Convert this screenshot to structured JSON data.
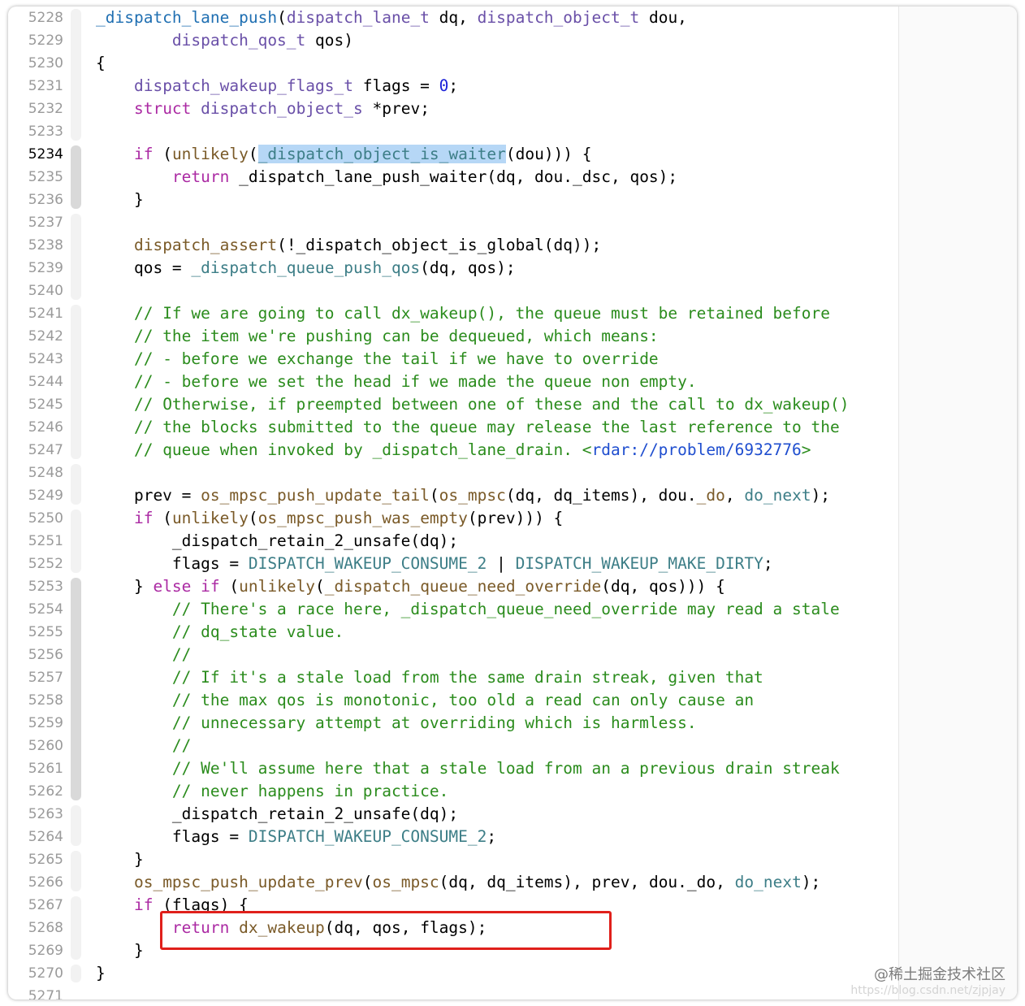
{
  "colors": {
    "keyword": "#ab2aa3",
    "type": "#6a50a8",
    "func": "#3d7e87",
    "def": "#1f6fb2",
    "comment": "#2b8c1d",
    "number": "#1c22d8",
    "link": "#1f4ecf",
    "macro": "#7a5a28",
    "selection": "#b6d7f6",
    "text": "#000000",
    "annotation_box": "#e0201b"
  },
  "active_line": 5234,
  "lines": [
    {
      "n": 5228,
      "tokens": [
        [
          "def",
          "_dispatch_lane_push"
        ],
        [
          "p",
          "("
        ],
        [
          "type",
          "dispatch_lane_t"
        ],
        [
          "p",
          " dq, "
        ],
        [
          "type",
          "dispatch_object_t"
        ],
        [
          "p",
          " dou,"
        ]
      ]
    },
    {
      "n": 5229,
      "tokens": [
        [
          "p",
          "        "
        ],
        [
          "type",
          "dispatch_qos_t"
        ],
        [
          "p",
          " qos)"
        ]
      ]
    },
    {
      "n": 5230,
      "tokens": [
        [
          "p",
          "{"
        ]
      ]
    },
    {
      "n": 5231,
      "tokens": [
        [
          "p",
          "    "
        ],
        [
          "type",
          "dispatch_wakeup_flags_t"
        ],
        [
          "p",
          " flags = "
        ],
        [
          "num",
          "0"
        ],
        [
          "p",
          ";"
        ]
      ]
    },
    {
      "n": 5232,
      "tokens": [
        [
          "p",
          "    "
        ],
        [
          "kw",
          "struct"
        ],
        [
          "p",
          " "
        ],
        [
          "type",
          "dispatch_object_s"
        ],
        [
          "p",
          " *prev;"
        ]
      ]
    },
    {
      "n": 5233,
      "tokens": []
    },
    {
      "n": 5234,
      "tokens": [
        [
          "p",
          "    "
        ],
        [
          "kw",
          "if"
        ],
        [
          "p",
          " ("
        ],
        [
          "macro",
          "unlikely"
        ],
        [
          "p",
          "("
        ],
        [
          "sel",
          "_dispatch_object_is_waiter"
        ],
        [
          "p",
          "(dou))) {"
        ]
      ]
    },
    {
      "n": 5235,
      "tokens": [
        [
          "p",
          "        "
        ],
        [
          "kw",
          "return"
        ],
        [
          "p",
          " _dispatch_lane_push_waiter(dq, dou._dsc, qos);"
        ]
      ]
    },
    {
      "n": 5236,
      "tokens": [
        [
          "p",
          "    }"
        ]
      ]
    },
    {
      "n": 5237,
      "tokens": []
    },
    {
      "n": 5238,
      "tokens": [
        [
          "p",
          "    "
        ],
        [
          "macro",
          "dispatch_assert"
        ],
        [
          "p",
          "(!_dispatch_object_is_global(dq));"
        ]
      ]
    },
    {
      "n": 5239,
      "tokens": [
        [
          "p",
          "    qos = "
        ],
        [
          "func",
          "_dispatch_queue_push_qos"
        ],
        [
          "p",
          "(dq, qos);"
        ]
      ]
    },
    {
      "n": 5240,
      "tokens": []
    },
    {
      "n": 5241,
      "tokens": [
        [
          "p",
          "    "
        ],
        [
          "cm",
          "// If we are going to call dx_wakeup(), the queue must be retained before"
        ]
      ]
    },
    {
      "n": 5242,
      "tokens": [
        [
          "p",
          "    "
        ],
        [
          "cm",
          "// the item we're pushing can be dequeued, which means:"
        ]
      ]
    },
    {
      "n": 5243,
      "tokens": [
        [
          "p",
          "    "
        ],
        [
          "cm",
          "// - before we exchange the tail if we have to override"
        ]
      ]
    },
    {
      "n": 5244,
      "tokens": [
        [
          "p",
          "    "
        ],
        [
          "cm",
          "// - before we set the head if we made the queue non empty."
        ]
      ]
    },
    {
      "n": 5245,
      "tokens": [
        [
          "p",
          "    "
        ],
        [
          "cm",
          "// Otherwise, if preempted between one of these and the call to dx_wakeup()"
        ]
      ]
    },
    {
      "n": 5246,
      "tokens": [
        [
          "p",
          "    "
        ],
        [
          "cm",
          "// the blocks submitted to the queue may release the last reference to the"
        ]
      ]
    },
    {
      "n": 5247,
      "tokens": [
        [
          "p",
          "    "
        ],
        [
          "cm",
          "// queue when invoked by _dispatch_lane_drain. <"
        ],
        [
          "link",
          "rdar://problem/6932776"
        ],
        [
          "cm",
          ">"
        ]
      ]
    },
    {
      "n": 5248,
      "tokens": []
    },
    {
      "n": 5249,
      "tokens": [
        [
          "p",
          "    prev = "
        ],
        [
          "macro",
          "os_mpsc_push_update_tail"
        ],
        [
          "p",
          "("
        ],
        [
          "macro",
          "os_mpsc"
        ],
        [
          "p",
          "(dq, dq_items), dou."
        ],
        [
          "macro",
          "_do"
        ],
        [
          "p",
          ", "
        ],
        [
          "func",
          "do_next"
        ],
        [
          "p",
          ");"
        ]
      ]
    },
    {
      "n": 5250,
      "tokens": [
        [
          "p",
          "    "
        ],
        [
          "kw",
          "if"
        ],
        [
          "p",
          " ("
        ],
        [
          "macro",
          "unlikely"
        ],
        [
          "p",
          "("
        ],
        [
          "macro",
          "os_mpsc_push_was_empty"
        ],
        [
          "p",
          "(prev))) {"
        ]
      ]
    },
    {
      "n": 5251,
      "tokens": [
        [
          "p",
          "        _dispatch_retain_2_unsafe(dq);"
        ]
      ]
    },
    {
      "n": 5252,
      "tokens": [
        [
          "p",
          "        flags = "
        ],
        [
          "func",
          "DISPATCH_WAKEUP_CONSUME_2"
        ],
        [
          "p",
          " | "
        ],
        [
          "func",
          "DISPATCH_WAKEUP_MAKE_DIRTY"
        ],
        [
          "p",
          ";"
        ]
      ]
    },
    {
      "n": 5253,
      "tokens": [
        [
          "p",
          "    } "
        ],
        [
          "kw",
          "else if"
        ],
        [
          "p",
          " ("
        ],
        [
          "macro",
          "unlikely"
        ],
        [
          "p",
          "("
        ],
        [
          "macro",
          "_dispatch_queue_need_override"
        ],
        [
          "p",
          "(dq, qos))) {"
        ]
      ]
    },
    {
      "n": 5254,
      "tokens": [
        [
          "p",
          "        "
        ],
        [
          "cm",
          "// There's a race here, _dispatch_queue_need_override may read a stale"
        ]
      ]
    },
    {
      "n": 5255,
      "tokens": [
        [
          "p",
          "        "
        ],
        [
          "cm",
          "// dq_state value."
        ]
      ]
    },
    {
      "n": 5256,
      "tokens": [
        [
          "p",
          "        "
        ],
        [
          "cm",
          "//"
        ]
      ]
    },
    {
      "n": 5257,
      "tokens": [
        [
          "p",
          "        "
        ],
        [
          "cm",
          "// If it's a stale load from the same drain streak, given that"
        ]
      ]
    },
    {
      "n": 5258,
      "tokens": [
        [
          "p",
          "        "
        ],
        [
          "cm",
          "// the max qos is monotonic, too old a read can only cause an"
        ]
      ]
    },
    {
      "n": 5259,
      "tokens": [
        [
          "p",
          "        "
        ],
        [
          "cm",
          "// unnecessary attempt at overriding which is harmless."
        ]
      ]
    },
    {
      "n": 5260,
      "tokens": [
        [
          "p",
          "        "
        ],
        [
          "cm",
          "//"
        ]
      ]
    },
    {
      "n": 5261,
      "tokens": [
        [
          "p",
          "        "
        ],
        [
          "cm",
          "// We'll assume here that a stale load from an a previous drain streak"
        ]
      ]
    },
    {
      "n": 5262,
      "tokens": [
        [
          "p",
          "        "
        ],
        [
          "cm",
          "// never happens in practice."
        ]
      ]
    },
    {
      "n": 5263,
      "tokens": [
        [
          "p",
          "        _dispatch_retain_2_unsafe(dq);"
        ]
      ]
    },
    {
      "n": 5264,
      "tokens": [
        [
          "p",
          "        flags = "
        ],
        [
          "func",
          "DISPATCH_WAKEUP_CONSUME_2"
        ],
        [
          "p",
          ";"
        ]
      ]
    },
    {
      "n": 5265,
      "tokens": [
        [
          "p",
          "    }"
        ]
      ]
    },
    {
      "n": 5266,
      "tokens": [
        [
          "p",
          "    "
        ],
        [
          "macro",
          "os_mpsc_push_update_prev"
        ],
        [
          "p",
          "("
        ],
        [
          "macro",
          "os_mpsc"
        ],
        [
          "p",
          "(dq, dq_items), prev, dou._do, "
        ],
        [
          "func",
          "do_next"
        ],
        [
          "p",
          ");"
        ]
      ]
    },
    {
      "n": 5267,
      "tokens": [
        [
          "p",
          "    "
        ],
        [
          "kw",
          "if"
        ],
        [
          "p",
          " (flags) {"
        ]
      ]
    },
    {
      "n": 5268,
      "tokens": [
        [
          "p",
          "        "
        ],
        [
          "kw",
          "return"
        ],
        [
          "p",
          " "
        ],
        [
          "macro",
          "dx_wakeup"
        ],
        [
          "p",
          "(dq, qos, flags);"
        ]
      ]
    },
    {
      "n": 5269,
      "tokens": [
        [
          "p",
          "    }"
        ]
      ]
    },
    {
      "n": 5270,
      "tokens": [
        [
          "p",
          "}"
        ]
      ]
    },
    {
      "n": 5271,
      "tokens": []
    }
  ],
  "watermark": {
    "text": "@稀土掘金技术社区",
    "url": "https://blog.csdn.net/zjpjay"
  }
}
